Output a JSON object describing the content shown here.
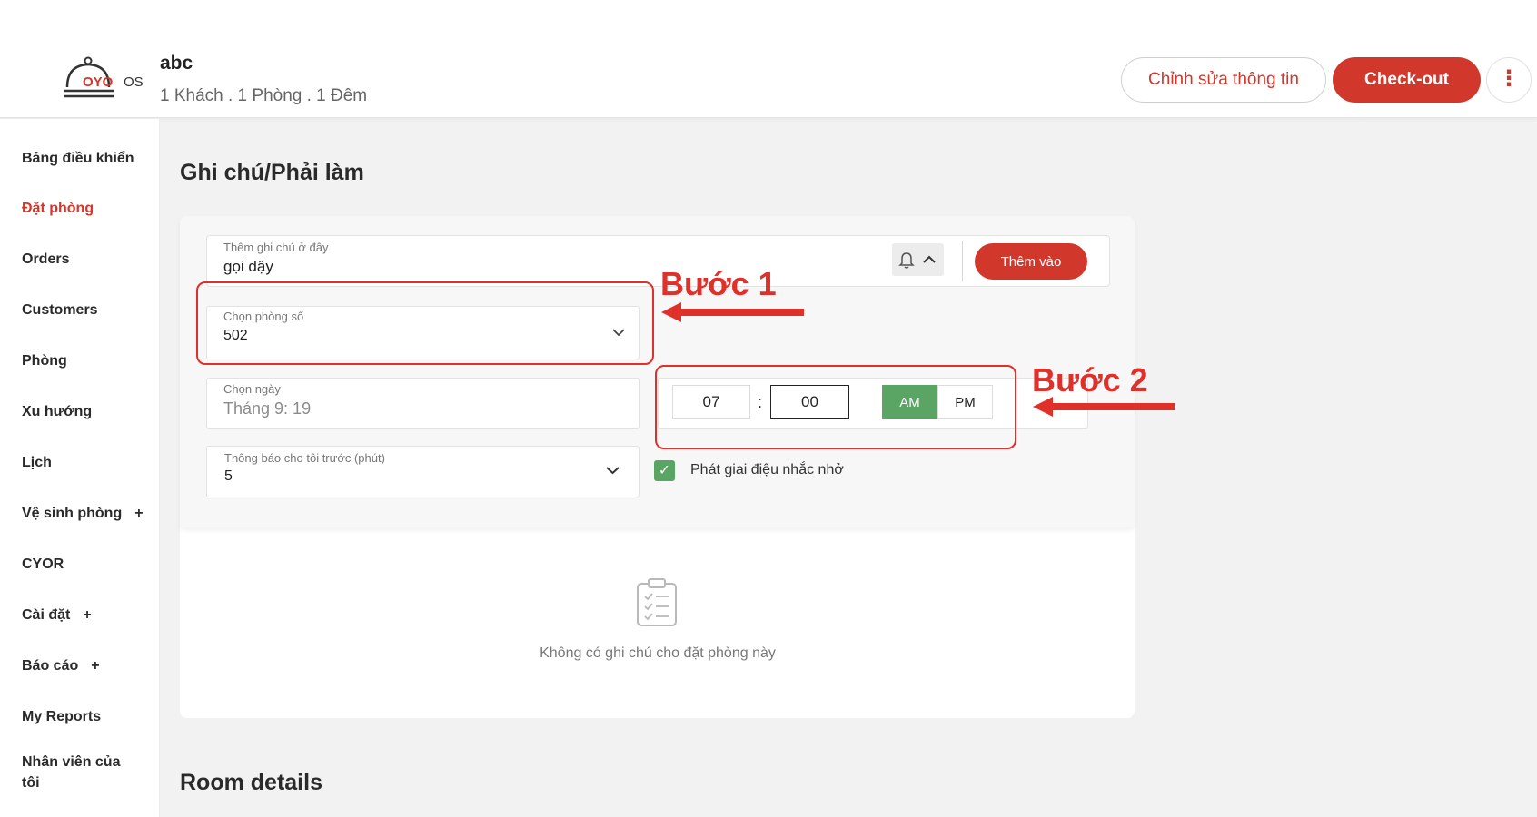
{
  "header": {
    "logo_text": "OYO",
    "logo_suffix": "OS",
    "guest_name": "abc",
    "guest_meta": "1 Khách . 1 Phòng . 1 Đêm",
    "edit_button": "Chỉnh sửa thông tin",
    "checkout_button": "Check-out",
    "more_icon": "more-vertical-icon"
  },
  "sidebar": {
    "items": [
      {
        "label": "Bảng điều khiển"
      },
      {
        "label": "Đặt phòng",
        "active": true
      },
      {
        "label": "Orders"
      },
      {
        "label": "Customers"
      },
      {
        "label": "Phòng"
      },
      {
        "label": "Xu hướng"
      },
      {
        "label": "Lịch"
      },
      {
        "label": "Vệ sinh phòng",
        "expand": "+"
      },
      {
        "label": "CYOR"
      },
      {
        "label": "Cài đặt",
        "expand": "+"
      },
      {
        "label": "Báo cáo",
        "expand": "+"
      },
      {
        "label": "My Reports"
      },
      {
        "label": "Nhân viên của tôi"
      }
    ]
  },
  "notes_section": {
    "title": "Ghi chú/Phải làm",
    "note_label": "Thêm ghi chú ở đây",
    "note_value": "gọi dậy",
    "add_button": "Thêm vào",
    "room_label": "Chọn phòng số",
    "room_value": "502",
    "date_label": "Chọn ngày",
    "date_value": "Tháng 9: 19",
    "hour": "07",
    "time_separator": ":",
    "minute": "00",
    "am": "AM",
    "pm": "PM",
    "selected_period": "AM",
    "notify_label": "Thông báo cho tôi trước (phút)",
    "notify_value": "5",
    "melody_label": "Phát giai điệu nhắc nhở",
    "melody_checked": true,
    "empty_text": "Không có ghi chú cho đặt phòng này"
  },
  "room_details": {
    "title": "Room details"
  },
  "annotations": {
    "step1": "Bước 1",
    "step2": "Bước 2",
    "color": "#e0302a"
  },
  "colors": {
    "brand_red": "#d2372c",
    "success_green": "#5aa464"
  }
}
